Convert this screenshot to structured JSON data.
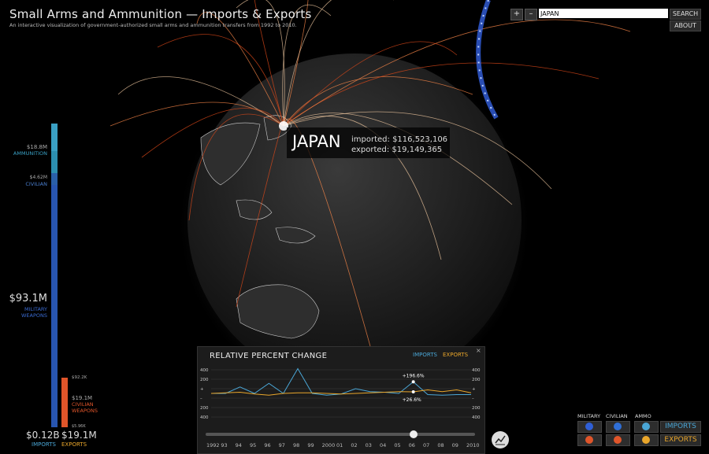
{
  "header": {
    "title": "Small Arms and Ammunition — Imports & Exports",
    "subtitle": "An interactive visualization of government-authorized small arms and ammunition transfers from 1992 to 2010."
  },
  "toolbar": {
    "zoom_in": "+",
    "zoom_out": "–",
    "search_value": "JAPAN",
    "search_button": "SEARCH",
    "about_button": "ABOUT"
  },
  "country": {
    "name": "JAPAN",
    "imported": "imported: $116,523,106",
    "exported": "exported: $19,149,365"
  },
  "imports_bar": {
    "ammunition_value": "$18.8M",
    "ammunition_label": "AMMUNITION",
    "civilian_value": "$4.62M",
    "civilian_label": "CIVILIAN",
    "military_value": "$93.1M",
    "military_label_1": "MILITARY",
    "military_label_2": "WEAPONS",
    "total": "$0.12B",
    "total_label": "IMPORTS"
  },
  "exports_bar": {
    "top_value": "$92.2K",
    "civilian_value": "$19.1M",
    "civilian_label_1": "CIVILIAN",
    "civilian_label_2": "WEAPONS",
    "bottom_value": "$5.96K",
    "total": "$19.1M",
    "total_label": "EXPORTS"
  },
  "chart_panel": {
    "title": "RELATIVE PERCENT CHANGE",
    "legend_imports": "IMPORTS",
    "legend_exports": "EXPORTS",
    "close": "×",
    "annotation_imports": "+196.6%",
    "annotation_exports": "+26.6%",
    "y_labels_left": [
      "400",
      "200",
      "+",
      "–",
      "200",
      "400"
    ],
    "y_labels_right": [
      "400",
      "200",
      "+",
      "–",
      "200",
      "400"
    ],
    "years": [
      "1992",
      "93",
      "94",
      "95",
      "96",
      "97",
      "98",
      "99",
      "2000",
      "01",
      "02",
      "03",
      "04",
      "05",
      "06",
      "07",
      "08",
      "09",
      "2010"
    ]
  },
  "chart_data": {
    "type": "line",
    "title": "RELATIVE PERCENT CHANGE",
    "x": [
      "1992",
      "93",
      "94",
      "95",
      "96",
      "97",
      "98",
      "99",
      "2000",
      "01",
      "02",
      "03",
      "04",
      "05",
      "06",
      "07",
      "08",
      "09",
      "2010"
    ],
    "ylim": [
      -400,
      400
    ],
    "series": [
      {
        "name": "IMPORTS",
        "color": "#4aa6d6",
        "values": [
          0,
          0,
          110,
          0,
          170,
          0,
          420,
          0,
          -30,
          -10,
          80,
          30,
          20,
          0,
          196.6,
          -20,
          -30,
          -20,
          -20
        ]
      },
      {
        "name": "EXPORTS",
        "color": "#e9a62b",
        "values": [
          0,
          10,
          20,
          -10,
          -30,
          0,
          10,
          10,
          0,
          -10,
          0,
          10,
          20,
          30,
          26.6,
          60,
          30,
          60,
          10
        ]
      }
    ]
  },
  "controls": {
    "col_military": "MILITARY",
    "col_civilian": "CIVILIAN",
    "col_ammo": "AMMO",
    "imports_button": "IMPORTS",
    "exports_button": "EXPORTS",
    "imports_color": "#4aa6d6",
    "exports_color": "#e9a62b",
    "import_check_color": "#2f6fd6",
    "export_check_color": "#e0552a"
  },
  "chart_toggle_icon": "line-chart-icon"
}
